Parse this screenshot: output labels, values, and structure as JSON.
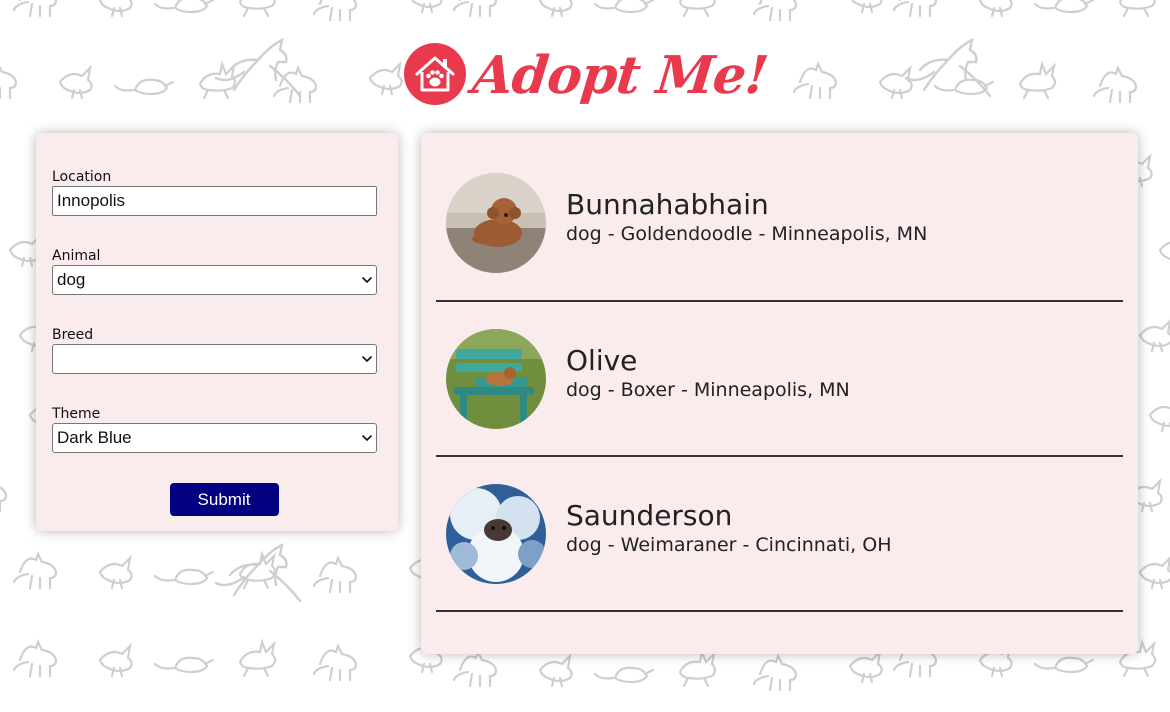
{
  "header": {
    "logo_text": "Adopt Me!",
    "brand_color": "#e8394d"
  },
  "search_form": {
    "location": {
      "label": "Location",
      "value": "Innopolis"
    },
    "animal": {
      "label": "Animal",
      "selected": "dog"
    },
    "breed": {
      "label": "Breed",
      "selected": ""
    },
    "theme": {
      "label": "Theme",
      "selected": "Dark Blue"
    },
    "submit_label": "Submit",
    "submit_color": "#000080"
  },
  "results": [
    {
      "name": "Bunnahabhain",
      "details": "dog - Goldendoodle - Minneapolis, MN",
      "photo_icon": "dog-photo-goldendoodle"
    },
    {
      "name": "Olive",
      "details": "dog - Boxer - Minneapolis, MN",
      "photo_icon": "dog-photo-boxer"
    },
    {
      "name": "Saunderson",
      "details": "dog - Weimaraner - Cincinnati, OH",
      "photo_icon": "dog-photo-weimaraner"
    }
  ],
  "colors": {
    "panel_background": "#faebed",
    "divider": "#333333",
    "pattern_stroke": "#cfcfcf"
  }
}
